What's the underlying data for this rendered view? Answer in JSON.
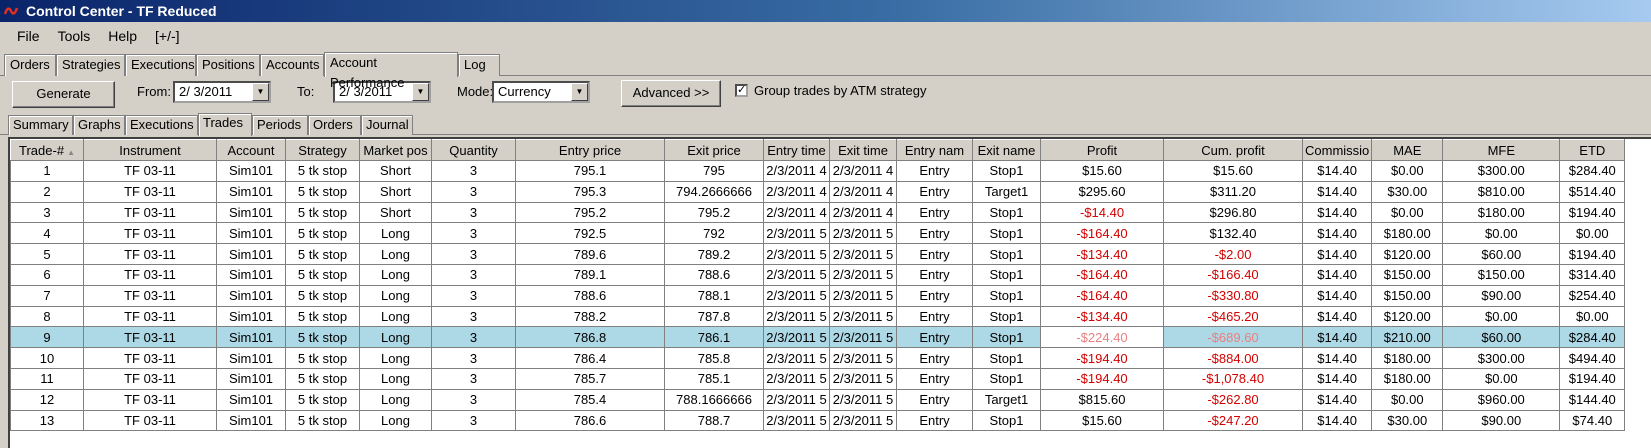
{
  "window": {
    "title": "Control Center - TF Reduced"
  },
  "menu": [
    "File",
    "Tools",
    "Help",
    "[+/-]"
  ],
  "main_tabs": [
    "Orders",
    "Strategies",
    "Executions",
    "Positions",
    "Accounts",
    "Account Performance",
    "Log"
  ],
  "toolbar": {
    "generate_label": "Generate",
    "from_label": "From:",
    "from_value": "2/  3/2011",
    "to_label": "To:",
    "to_value": "2/  3/2011",
    "mode_label": "Mode:",
    "mode_value": "Currency",
    "advanced_label": "Advanced >>",
    "group_label": "Group trades by ATM strategy",
    "group_checked": "✓"
  },
  "sub_tabs": [
    "Summary",
    "Graphs",
    "Executions",
    "Trades",
    "Periods",
    "Orders",
    "Journal"
  ],
  "grid": {
    "columns": [
      "Trade-#",
      "Instrument",
      "Account",
      "Strategy",
      "Market pos",
      "Quantity",
      "Entry price",
      "Exit price",
      "Entry time",
      "Exit time",
      "Entry nam",
      "Exit name",
      "Profit",
      "Cum. profit",
      "Commissio",
      "MAE",
      "MFE",
      "ETD"
    ],
    "sort_indicator": "▲",
    "rows": [
      [
        "1",
        "TF 03-11",
        "Sim101",
        "5 tk stop",
        "Short",
        "3",
        "795.1",
        "795",
        "2/3/2011 4",
        "2/3/2011 4",
        "Entry",
        "Stop1",
        "$15.60",
        "$15.60",
        "$14.40",
        "$0.00",
        "$300.00",
        "$284.40"
      ],
      [
        "2",
        "TF 03-11",
        "Sim101",
        "5 tk stop",
        "Short",
        "3",
        "795.3",
        "794.2666666",
        "2/3/2011 4",
        "2/3/2011 4",
        "Entry",
        "Target1",
        "$295.60",
        "$311.20",
        "$14.40",
        "$30.00",
        "$810.00",
        "$514.40"
      ],
      [
        "3",
        "TF 03-11",
        "Sim101",
        "5 tk stop",
        "Short",
        "3",
        "795.2",
        "795.2",
        "2/3/2011 4",
        "2/3/2011 4",
        "Entry",
        "Stop1",
        "-$14.40",
        "$296.80",
        "$14.40",
        "$0.00",
        "$180.00",
        "$194.40"
      ],
      [
        "4",
        "TF 03-11",
        "Sim101",
        "5 tk stop",
        "Long",
        "3",
        "792.5",
        "792",
        "2/3/2011 5",
        "2/3/2011 5",
        "Entry",
        "Stop1",
        "-$164.40",
        "$132.40",
        "$14.40",
        "$180.00",
        "$0.00",
        "$0.00"
      ],
      [
        "5",
        "TF 03-11",
        "Sim101",
        "5 tk stop",
        "Long",
        "3",
        "789.6",
        "789.2",
        "2/3/2011 5",
        "2/3/2011 5",
        "Entry",
        "Stop1",
        "-$134.40",
        "-$2.00",
        "$14.40",
        "$120.00",
        "$60.00",
        "$194.40"
      ],
      [
        "6",
        "TF 03-11",
        "Sim101",
        "5 tk stop",
        "Long",
        "3",
        "789.1",
        "788.6",
        "2/3/2011 5",
        "2/3/2011 5",
        "Entry",
        "Stop1",
        "-$164.40",
        "-$166.40",
        "$14.40",
        "$150.00",
        "$150.00",
        "$314.40"
      ],
      [
        "7",
        "TF 03-11",
        "Sim101",
        "5 tk stop",
        "Long",
        "3",
        "788.6",
        "788.1",
        "2/3/2011 5",
        "2/3/2011 5",
        "Entry",
        "Stop1",
        "-$164.40",
        "-$330.80",
        "$14.40",
        "$150.00",
        "$90.00",
        "$254.40"
      ],
      [
        "8",
        "TF 03-11",
        "Sim101",
        "5 tk stop",
        "Long",
        "3",
        "788.2",
        "787.8",
        "2/3/2011 5",
        "2/3/2011 5",
        "Entry",
        "Stop1",
        "-$134.40",
        "-$465.20",
        "$14.40",
        "$120.00",
        "$0.00",
        "$0.00"
      ],
      [
        "9",
        "TF 03-11",
        "Sim101",
        "5 tk stop",
        "Long",
        "3",
        "786.8",
        "786.1",
        "2/3/2011 5",
        "2/3/2011 5",
        "Entry",
        "Stop1",
        "-$224.40",
        "-$689.60",
        "$14.40",
        "$210.00",
        "$60.00",
        "$284.40"
      ],
      [
        "10",
        "TF 03-11",
        "Sim101",
        "5 tk stop",
        "Long",
        "3",
        "786.4",
        "785.8",
        "2/3/2011 5",
        "2/3/2011 5",
        "Entry",
        "Stop1",
        "-$194.40",
        "-$884.00",
        "$14.40",
        "$180.00",
        "$300.00",
        "$494.40"
      ],
      [
        "11",
        "TF 03-11",
        "Sim101",
        "5 tk stop",
        "Long",
        "3",
        "785.7",
        "785.1",
        "2/3/2011 5",
        "2/3/2011 5",
        "Entry",
        "Stop1",
        "-$194.40",
        "-$1,078.40",
        "$14.40",
        "$180.00",
        "$0.00",
        "$194.40"
      ],
      [
        "12",
        "TF 03-11",
        "Sim101",
        "5 tk stop",
        "Long",
        "3",
        "785.4",
        "788.1666666",
        "2/3/2011 5",
        "2/3/2011 5",
        "Entry",
        "Target1",
        "$815.60",
        "-$262.80",
        "$14.40",
        "$0.00",
        "$960.00",
        "$144.40"
      ],
      [
        "13",
        "TF 03-11",
        "Sim101",
        "5 tk stop",
        "Long",
        "3",
        "786.6",
        "788.7",
        "2/3/2011 5",
        "2/3/2011 5",
        "Entry",
        "Stop1",
        "$15.60",
        "-$247.20",
        "$14.40",
        "$30.00",
        "$90.00",
        "$74.40"
      ]
    ],
    "selected_row": 9
  },
  "colors": {
    "selection": "#add8e6",
    "negative": "#d40000",
    "title_start": "#0a246a",
    "title_end": "#a6caf0"
  }
}
